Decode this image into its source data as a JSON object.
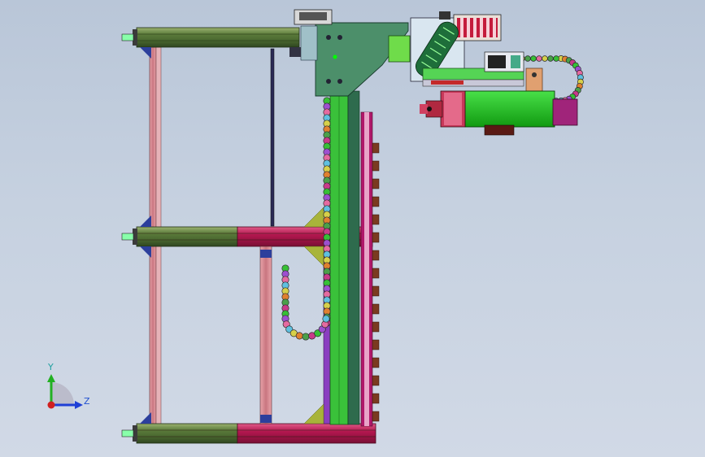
{
  "viewport": {
    "background_top": "#b9c6d8",
    "background_bottom": "#d1d9e6"
  },
  "colors": {
    "beam_green": "#4e6b36",
    "beam_green_light": "#7d9a55",
    "beam_red": "#b0184e",
    "beam_red_light": "#d03a6e",
    "rail_pink": "#d98b93",
    "rail_blue": "#2c3f9c",
    "plate_teal": "#4c8f6a",
    "motor_green": "#22c322",
    "motor_purple": "#a0247a",
    "olive_triangle": "#a8b43a",
    "chain_outline": "#3a3a3a"
  },
  "triad": {
    "y_label": "Y",
    "z_label": "Z",
    "y_color": "#22b022",
    "z_color": "#1f3fd6",
    "origin_color": "#d02020"
  }
}
